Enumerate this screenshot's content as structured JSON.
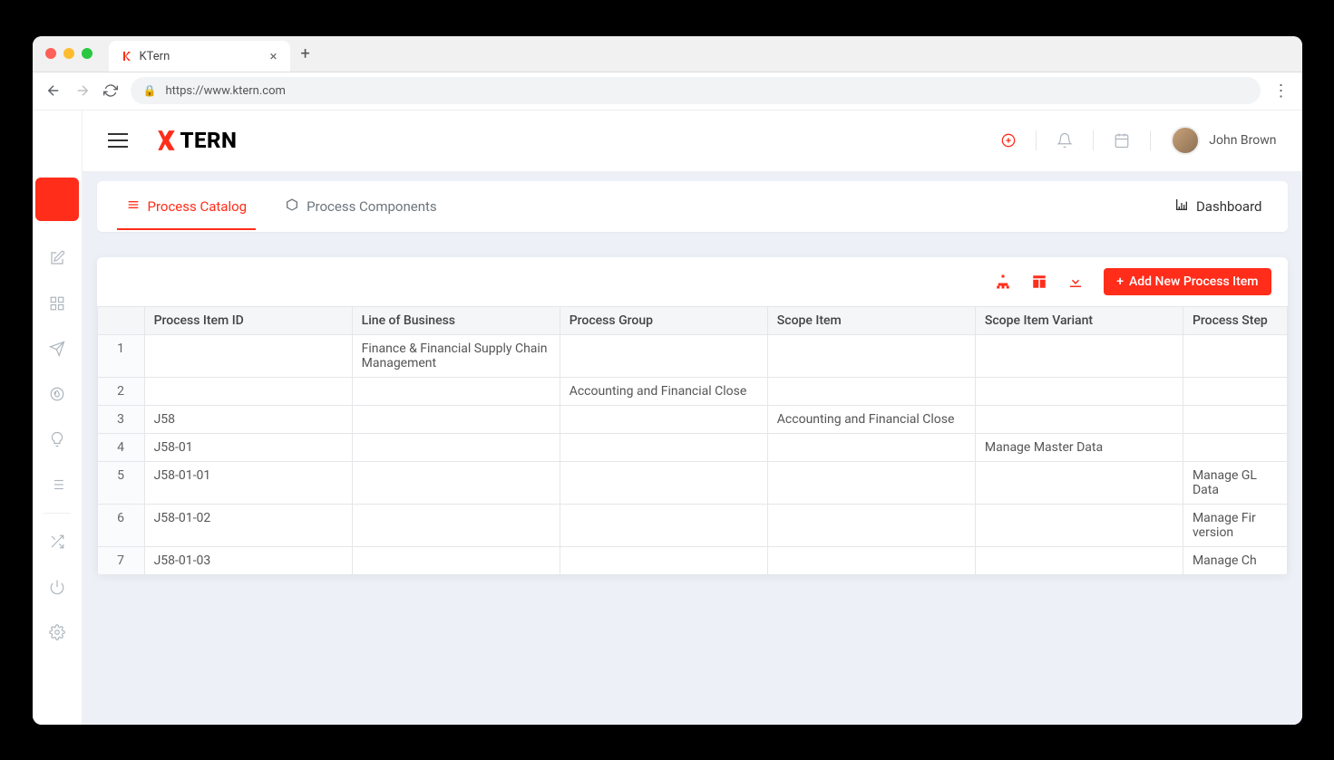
{
  "browser": {
    "tab_title": "KTern",
    "url": "https://www.ktern.com"
  },
  "brand": "TERN",
  "user": {
    "name": "John Brown"
  },
  "tabs": {
    "catalog": "Process Catalog",
    "components": "Process Components",
    "dashboard": "Dashboard"
  },
  "actions": {
    "add_new": "Add New Process Item"
  },
  "table": {
    "headers": {
      "id": "Process Item ID",
      "lob": "Line of Business",
      "pg": "Process Group",
      "si": "Scope Item",
      "siv": "Scope Item Variant",
      "ps": "Process Step"
    },
    "rows": [
      {
        "n": "1",
        "id": "",
        "lob": "Finance & Financial Supply Chain Management",
        "pg": "",
        "si": "",
        "siv": "",
        "ps": ""
      },
      {
        "n": "2",
        "id": "",
        "lob": "",
        "pg": "Accounting and Financial Close",
        "si": "",
        "siv": "",
        "ps": ""
      },
      {
        "n": "3",
        "id": "J58",
        "lob": "",
        "pg": "",
        "si": "Accounting and Financial Close",
        "siv": "",
        "ps": ""
      },
      {
        "n": "4",
        "id": "J58-01",
        "lob": "",
        "pg": "",
        "si": "",
        "siv": "Manage Master Data",
        "ps": ""
      },
      {
        "n": "5",
        "id": "J58-01-01",
        "lob": "",
        "pg": "",
        "si": "",
        "siv": "",
        "ps": "Manage GL Data"
      },
      {
        "n": "6",
        "id": "J58-01-02",
        "lob": "",
        "pg": "",
        "si": "",
        "siv": "",
        "ps": "Manage Fir version"
      },
      {
        "n": "7",
        "id": "J58-01-03",
        "lob": "",
        "pg": "",
        "si": "",
        "siv": "",
        "ps": "Manage Ch"
      }
    ]
  }
}
